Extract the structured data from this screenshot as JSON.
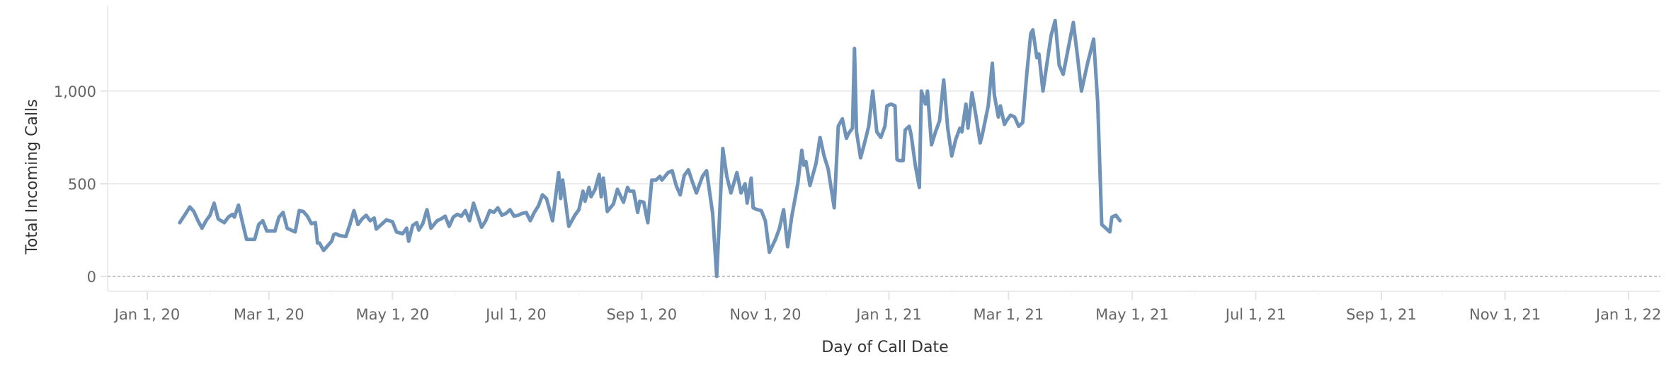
{
  "chart_data": {
    "type": "line",
    "title": "",
    "xlabel": "Day of Call Date",
    "ylabel": "Total Incoming Calls",
    "y_ticks": [
      0,
      500,
      1000
    ],
    "y_tick_labels": [
      "0",
      "500",
      "1,000"
    ],
    "ylim": [
      -60,
      1450
    ],
    "x_ticks": [
      "2020-01-01",
      "2020-03-01",
      "2020-05-01",
      "2020-07-01",
      "2020-09-01",
      "2020-11-01",
      "2021-01-01",
      "2021-03-01",
      "2021-05-01",
      "2021-07-01",
      "2021-09-01",
      "2021-11-01",
      "2022-01-01"
    ],
    "x_tick_labels": [
      "Jan 1, 20",
      "Mar 1, 20",
      "May 1, 20",
      "Jul 1, 20",
      "Sep 1, 20",
      "Nov 1, 20",
      "Jan 1, 21",
      "Mar 1, 21",
      "May 1, 21",
      "Jul 1, 21",
      "Sep 1, 21",
      "Nov 1, 21",
      "Jan 1, 22"
    ],
    "xlim": [
      "2019-12-10",
      "2022-01-15"
    ],
    "grid": "horizontal",
    "legend": "none",
    "series": [
      {
        "name": "Total Incoming Calls",
        "color": "#6f93b8",
        "points": [
          [
            "2020-01-17",
            290
          ],
          [
            "2020-01-20",
            340
          ],
          [
            "2020-01-22",
            375
          ],
          [
            "2020-01-24",
            350
          ],
          [
            "2020-01-26",
            300
          ],
          [
            "2020-01-28",
            260
          ],
          [
            "2020-01-30",
            300
          ],
          [
            "2020-02-01",
            330
          ],
          [
            "2020-02-03",
            395
          ],
          [
            "2020-02-05",
            310
          ],
          [
            "2020-02-08",
            290
          ],
          [
            "2020-02-10",
            320
          ],
          [
            "2020-02-12",
            335
          ],
          [
            "2020-02-13",
            320
          ],
          [
            "2020-02-15",
            385
          ],
          [
            "2020-02-17",
            290
          ],
          [
            "2020-02-19",
            200
          ],
          [
            "2020-02-23",
            200
          ],
          [
            "2020-02-25",
            280
          ],
          [
            "2020-02-27",
            300
          ],
          [
            "2020-02-29",
            245
          ],
          [
            "2020-03-04",
            245
          ],
          [
            "2020-03-06",
            320
          ],
          [
            "2020-03-08",
            345
          ],
          [
            "2020-03-10",
            260
          ],
          [
            "2020-03-14",
            240
          ],
          [
            "2020-03-16",
            355
          ],
          [
            "2020-03-18",
            350
          ],
          [
            "2020-03-20",
            325
          ],
          [
            "2020-03-22",
            285
          ],
          [
            "2020-03-24",
            290
          ],
          [
            "2020-03-25",
            180
          ],
          [
            "2020-03-26",
            180
          ],
          [
            "2020-03-28",
            140
          ],
          [
            "2020-04-01",
            190
          ],
          [
            "2020-04-02",
            225
          ],
          [
            "2020-04-03",
            230
          ],
          [
            "2020-04-05",
            220
          ],
          [
            "2020-04-08",
            215
          ],
          [
            "2020-04-10",
            280
          ],
          [
            "2020-04-12",
            355
          ],
          [
            "2020-04-14",
            280
          ],
          [
            "2020-04-16",
            310
          ],
          [
            "2020-04-18",
            330
          ],
          [
            "2020-04-20",
            300
          ],
          [
            "2020-04-22",
            315
          ],
          [
            "2020-04-23",
            255
          ],
          [
            "2020-04-26",
            285
          ],
          [
            "2020-04-28",
            305
          ],
          [
            "2020-05-01",
            295
          ],
          [
            "2020-05-03",
            240
          ],
          [
            "2020-05-06",
            230
          ],
          [
            "2020-05-08",
            260
          ],
          [
            "2020-05-09",
            190
          ],
          [
            "2020-05-11",
            275
          ],
          [
            "2020-05-13",
            290
          ],
          [
            "2020-05-14",
            250
          ],
          [
            "2020-05-16",
            285
          ],
          [
            "2020-05-18",
            360
          ],
          [
            "2020-05-20",
            260
          ],
          [
            "2020-05-23",
            300
          ],
          [
            "2020-05-25",
            310
          ],
          [
            "2020-05-27",
            325
          ],
          [
            "2020-05-29",
            270
          ],
          [
            "2020-05-31",
            320
          ],
          [
            "2020-06-02",
            335
          ],
          [
            "2020-06-04",
            325
          ],
          [
            "2020-06-06",
            355
          ],
          [
            "2020-06-08",
            300
          ],
          [
            "2020-06-10",
            395
          ],
          [
            "2020-06-12",
            330
          ],
          [
            "2020-06-14",
            265
          ],
          [
            "2020-06-16",
            300
          ],
          [
            "2020-06-18",
            355
          ],
          [
            "2020-06-20",
            345
          ],
          [
            "2020-06-22",
            370
          ],
          [
            "2020-06-24",
            330
          ],
          [
            "2020-06-26",
            340
          ],
          [
            "2020-06-28",
            360
          ],
          [
            "2020-06-30",
            325
          ],
          [
            "2020-07-02",
            330
          ],
          [
            "2020-07-04",
            340
          ],
          [
            "2020-07-06",
            345
          ],
          [
            "2020-07-08",
            300
          ],
          [
            "2020-07-10",
            345
          ],
          [
            "2020-07-12",
            380
          ],
          [
            "2020-07-14",
            440
          ],
          [
            "2020-07-16",
            420
          ],
          [
            "2020-07-19",
            300
          ],
          [
            "2020-07-22",
            560
          ],
          [
            "2020-07-23",
            420
          ],
          [
            "2020-07-24",
            520
          ],
          [
            "2020-07-27",
            270
          ],
          [
            "2020-07-30",
            330
          ],
          [
            "2020-08-01",
            360
          ],
          [
            "2020-08-03",
            460
          ],
          [
            "2020-08-04",
            405
          ],
          [
            "2020-08-06",
            480
          ],
          [
            "2020-08-07",
            430
          ],
          [
            "2020-08-09",
            470
          ],
          [
            "2020-08-11",
            550
          ],
          [
            "2020-08-12",
            430
          ],
          [
            "2020-08-13",
            530
          ],
          [
            "2020-08-15",
            350
          ],
          [
            "2020-08-18",
            390
          ],
          [
            "2020-08-20",
            470
          ],
          [
            "2020-08-23",
            400
          ],
          [
            "2020-08-25",
            480
          ],
          [
            "2020-08-26",
            460
          ],
          [
            "2020-08-28",
            460
          ],
          [
            "2020-08-30",
            345
          ],
          [
            "2020-08-31",
            405
          ],
          [
            "2020-09-02",
            400
          ],
          [
            "2020-09-04",
            290
          ],
          [
            "2020-09-06",
            520
          ],
          [
            "2020-09-08",
            520
          ],
          [
            "2020-09-10",
            540
          ],
          [
            "2020-09-11",
            520
          ],
          [
            "2020-09-14",
            560
          ],
          [
            "2020-09-16",
            570
          ],
          [
            "2020-09-18",
            490
          ],
          [
            "2020-09-20",
            440
          ],
          [
            "2020-09-22",
            545
          ],
          [
            "2020-09-24",
            575
          ],
          [
            "2020-09-26",
            510
          ],
          [
            "2020-09-28",
            450
          ],
          [
            "2020-10-01",
            540
          ],
          [
            "2020-10-03",
            570
          ],
          [
            "2020-10-06",
            340
          ],
          [
            "2020-10-08",
            0
          ],
          [
            "2020-10-11",
            690
          ],
          [
            "2020-10-13",
            540
          ],
          [
            "2020-10-15",
            450
          ],
          [
            "2020-10-18",
            560
          ],
          [
            "2020-10-20",
            450
          ],
          [
            "2020-10-22",
            500
          ],
          [
            "2020-10-23",
            395
          ],
          [
            "2020-10-25",
            530
          ],
          [
            "2020-10-26",
            370
          ],
          [
            "2020-10-28",
            360
          ],
          [
            "2020-10-30",
            355
          ],
          [
            "2020-11-01",
            300
          ],
          [
            "2020-11-03",
            130
          ],
          [
            "2020-11-06",
            200
          ],
          [
            "2020-11-08",
            260
          ],
          [
            "2020-11-10",
            360
          ],
          [
            "2020-11-12",
            160
          ],
          [
            "2020-11-14",
            320
          ],
          [
            "2020-11-17",
            500
          ],
          [
            "2020-11-19",
            680
          ],
          [
            "2020-11-20",
            600
          ],
          [
            "2020-11-21",
            620
          ],
          [
            "2020-11-23",
            490
          ],
          [
            "2020-11-26",
            610
          ],
          [
            "2020-11-28",
            750
          ],
          [
            "2020-11-30",
            650
          ],
          [
            "2020-12-02",
            580
          ],
          [
            "2020-12-05",
            370
          ],
          [
            "2020-12-07",
            810
          ],
          [
            "2020-12-09",
            850
          ],
          [
            "2020-12-11",
            745
          ],
          [
            "2020-12-12",
            770
          ],
          [
            "2020-12-14",
            800
          ],
          [
            "2020-12-15",
            1230
          ],
          [
            "2020-12-16",
            780
          ],
          [
            "2020-12-18",
            640
          ],
          [
            "2020-12-20",
            720
          ],
          [
            "2020-12-22",
            810
          ],
          [
            "2020-12-24",
            1000
          ],
          [
            "2020-12-26",
            780
          ],
          [
            "2020-12-28",
            750
          ],
          [
            "2020-12-30",
            810
          ],
          [
            "2020-12-31",
            920
          ],
          [
            "2021-01-02",
            930
          ],
          [
            "2021-01-04",
            920
          ],
          [
            "2021-01-05",
            630
          ],
          [
            "2021-01-06",
            625
          ],
          [
            "2021-01-08",
            625
          ],
          [
            "2021-01-09",
            790
          ],
          [
            "2021-01-11",
            810
          ],
          [
            "2021-01-12",
            760
          ],
          [
            "2021-01-14",
            600
          ],
          [
            "2021-01-16",
            480
          ],
          [
            "2021-01-17",
            1000
          ],
          [
            "2021-01-19",
            930
          ],
          [
            "2021-01-20",
            1000
          ],
          [
            "2021-01-22",
            710
          ],
          [
            "2021-01-24",
            780
          ],
          [
            "2021-01-26",
            840
          ],
          [
            "2021-01-28",
            1060
          ],
          [
            "2021-01-30",
            800
          ],
          [
            "2021-02-01",
            650
          ],
          [
            "2021-02-03",
            740
          ],
          [
            "2021-02-05",
            800
          ],
          [
            "2021-02-06",
            780
          ],
          [
            "2021-02-08",
            930
          ],
          [
            "2021-02-09",
            800
          ],
          [
            "2021-02-11",
            990
          ],
          [
            "2021-02-13",
            860
          ],
          [
            "2021-02-15",
            720
          ],
          [
            "2021-02-16",
            760
          ],
          [
            "2021-02-19",
            920
          ],
          [
            "2021-02-21",
            1150
          ],
          [
            "2021-02-22",
            980
          ],
          [
            "2021-02-24",
            860
          ],
          [
            "2021-02-25",
            920
          ],
          [
            "2021-02-27",
            820
          ],
          [
            "2021-02-28",
            840
          ],
          [
            "2021-03-02",
            870
          ],
          [
            "2021-03-04",
            860
          ],
          [
            "2021-03-06",
            810
          ],
          [
            "2021-03-08",
            830
          ],
          [
            "2021-03-10",
            1090
          ],
          [
            "2021-03-12",
            1310
          ],
          [
            "2021-03-13",
            1330
          ],
          [
            "2021-03-15",
            1180
          ],
          [
            "2021-03-16",
            1200
          ],
          [
            "2021-03-18",
            1000
          ],
          [
            "2021-03-20",
            1150
          ],
          [
            "2021-03-22",
            1300
          ],
          [
            "2021-03-24",
            1380
          ],
          [
            "2021-03-26",
            1140
          ],
          [
            "2021-03-28",
            1090
          ],
          [
            "2021-03-31",
            1260
          ],
          [
            "2021-04-02",
            1370
          ],
          [
            "2021-04-04",
            1190
          ],
          [
            "2021-04-06",
            1000
          ],
          [
            "2021-04-09",
            1150
          ],
          [
            "2021-04-12",
            1280
          ],
          [
            "2021-04-14",
            940
          ],
          [
            "2021-04-16",
            280
          ],
          [
            "2021-04-18",
            260
          ],
          [
            "2021-04-20",
            240
          ],
          [
            "2021-04-21",
            320
          ],
          [
            "2021-04-23",
            330
          ],
          [
            "2021-04-25",
            300
          ]
        ]
      }
    ]
  }
}
